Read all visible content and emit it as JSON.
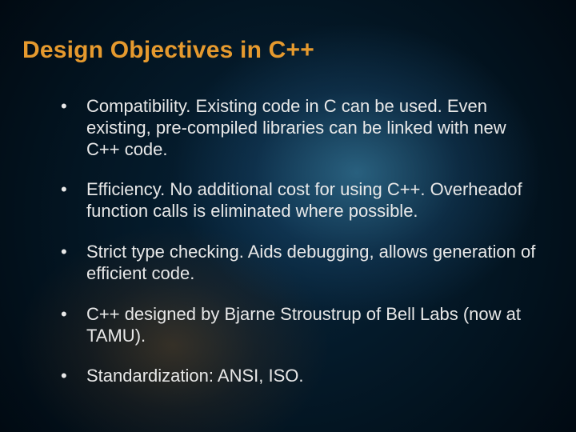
{
  "title": "Design Objectives in C++",
  "bullets": [
    "Compatibility.  Existing code in C can be used.  Even existing, pre-compiled libraries can be linked with new C++ code.",
    "Efficiency.  No additional cost for using C++.  Overheadof function calls is eliminated where possible.",
    "Strict type checking.  Aids debugging, allows generation of efficient code.",
    "C++ designed by Bjarne Stroustrup of Bell Labs (now at TAMU).",
    "Standardization: ANSI, ISO."
  ]
}
